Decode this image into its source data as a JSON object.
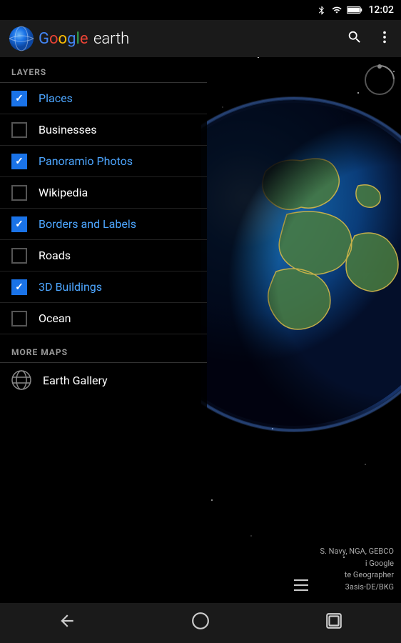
{
  "status_bar": {
    "time": "12:02",
    "bluetooth_icon": "bluetooth",
    "wifi_icon": "wifi",
    "battery_icon": "battery"
  },
  "top_bar": {
    "app_name": "earth",
    "google_text": "Google",
    "search_icon": "search",
    "more_icon": "more-vertical"
  },
  "layers_section": {
    "header": "LAYERS",
    "items": [
      {
        "label": "Places",
        "checked": true,
        "active": true
      },
      {
        "label": "Businesses",
        "checked": false,
        "active": false
      },
      {
        "label": "Panoramio Photos",
        "checked": true,
        "active": true
      },
      {
        "label": "Wikipedia",
        "checked": false,
        "active": false
      },
      {
        "label": "Borders and Labels",
        "checked": true,
        "active": true
      },
      {
        "label": "Roads",
        "checked": false,
        "active": false
      },
      {
        "label": "3D Buildings",
        "checked": true,
        "active": true
      },
      {
        "label": "Ocean",
        "checked": false,
        "active": false
      }
    ]
  },
  "more_maps_section": {
    "header": "MORE MAPS",
    "items": [
      {
        "label": "Earth Gallery",
        "icon": "globe"
      }
    ]
  },
  "attribution": {
    "lines": [
      "S. Navy, NGA, GEBCO",
      "i Google",
      "te Geographer",
      "3asis-DE/BKG"
    ]
  },
  "bottom_nav": {
    "back_icon": "back",
    "home_icon": "home",
    "recents_icon": "recents"
  }
}
